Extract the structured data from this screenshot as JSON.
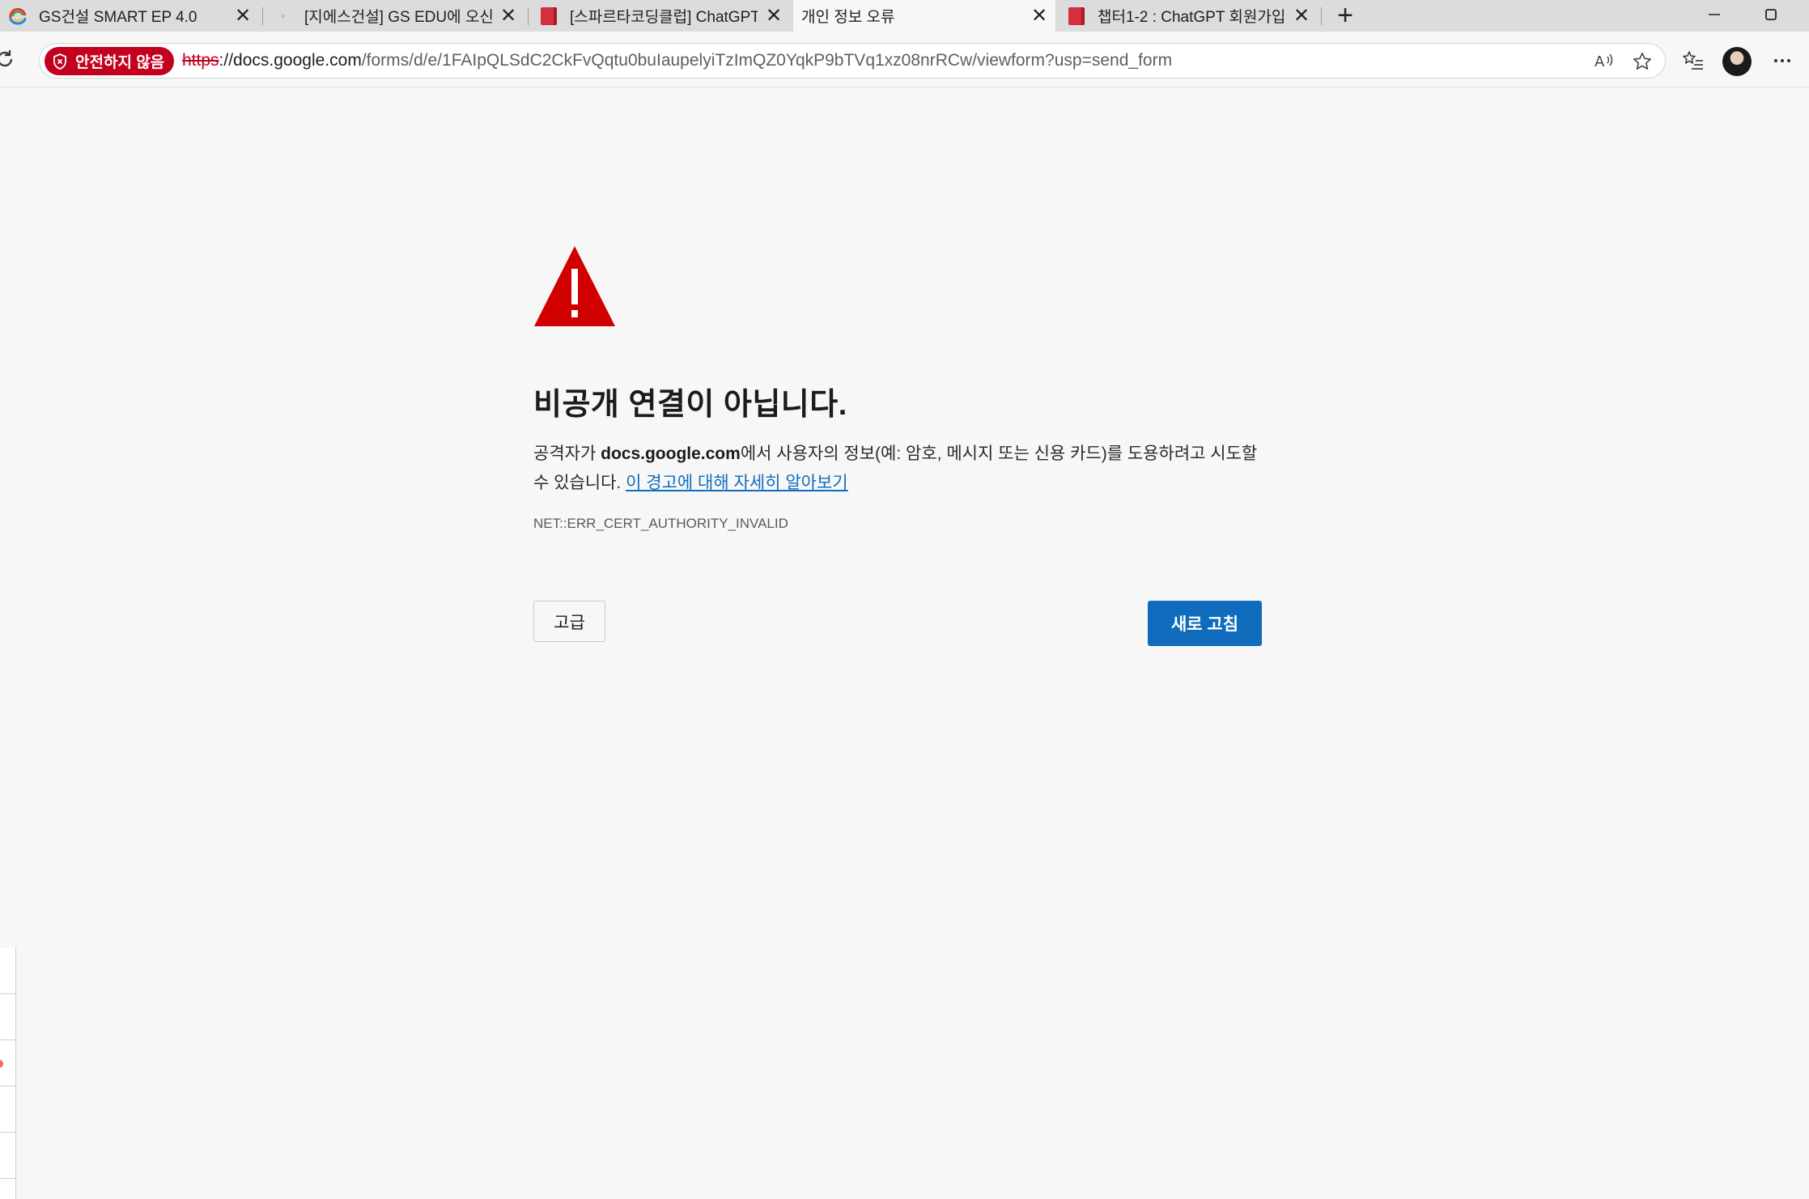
{
  "browser": {
    "tabs": [
      {
        "title": "GS건설 SMART EP 4.0",
        "favicon": "gs-logo-icon",
        "active": false
      },
      {
        "title": "[지에스건설] GS EDU에 오신",
        "favicon": "blank-page-icon",
        "active": false
      },
      {
        "title": "[스파르타코딩클럽] ChatGPT",
        "favicon": "red-book-icon",
        "active": false
      },
      {
        "title": "개인 정보 오류",
        "favicon": "none",
        "active": true
      },
      {
        "title": "챕터1-2 : ChatGPT 회원가입",
        "favicon": "red-book-icon",
        "active": false
      }
    ],
    "new_tab": "+",
    "security_chip": "안전하지 않음",
    "url": {
      "scheme": "https",
      "separator": "://",
      "host": "docs.google.com",
      "path": "/forms/d/e/1FAIpQLSdC2CkFvQqtu0buIaupelyiTzImQZ0YqkP9bTVq1xz08nrRCw/viewform?usp=send_form"
    },
    "toolbar_icons": [
      "reload-icon",
      "read-aloud-icon",
      "favorite-star-icon",
      "favorites-list-icon",
      "profile-avatar",
      "more-menu-icon"
    ],
    "window_controls": [
      "minimize-icon",
      "maximize-icon"
    ]
  },
  "error_page": {
    "icon": "warning-triangle-icon",
    "heading": "비공개 연결이 아닙니다.",
    "desc_prefix": "공격자가 ",
    "desc_host": "docs.google.com",
    "desc_suffix": "에서 사용자의 정보(예: 암호, 메시지 또는 신용 카드)를 도용하려고 시도할 수 있습니다. ",
    "learn_more": "이 경고에 대해 자세히 알아보기",
    "error_code": "NET::ERR_CERT_AUTHORITY_INVALID",
    "advanced_label": "고급",
    "reload_label": "새로 고침"
  },
  "colors": {
    "danger": "#c4001f",
    "warning_icon": "#d10000",
    "primary_button": "#0f6cbd",
    "link": "#0f6cbd",
    "page_bg": "#f7f7f7"
  }
}
